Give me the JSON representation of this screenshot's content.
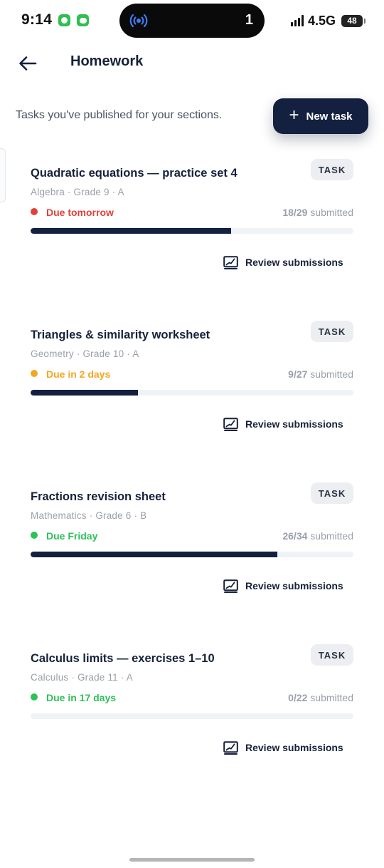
{
  "status_bar": {
    "time": "9:14",
    "island_count": "1",
    "network": "4.5G",
    "battery": "48"
  },
  "header": {
    "title": "Homework"
  },
  "subtitle": "Tasks you've published for your sections.",
  "new_task_label": "New task",
  "colors": {
    "navy": "#13203f",
    "red": "#e0413a",
    "orange": "#f5a623",
    "green": "#2ec15a",
    "track": "#eff2f6"
  },
  "tasks": [
    {
      "title": "Quadratic equations — practice set 4",
      "meta": "Algebra · Grade 9 · A",
      "badge": "TASK",
      "due": "Due tomorrow",
      "due_color": "#e0413a",
      "submitted_count": "18/29",
      "submitted_label": "submitted",
      "progress": 0.621,
      "review_label": "Review submissions"
    },
    {
      "title": "Triangles & similarity worksheet",
      "meta": "Geometry · Grade 10 · A",
      "badge": "TASK",
      "due": "Due in 2 days",
      "due_color": "#f5a623",
      "submitted_count": "9/27",
      "submitted_label": "submitted",
      "progress": 0.333,
      "review_label": "Review submissions"
    },
    {
      "title": "Fractions revision sheet",
      "meta": "Mathematics · Grade 6 · B",
      "badge": "TASK",
      "due": "Due Friday",
      "due_color": "#2ec15a",
      "submitted_count": "26/34",
      "submitted_label": "submitted",
      "progress": 0.765,
      "review_label": "Review submissions"
    },
    {
      "title": "Calculus limits — exercises 1–10",
      "meta": "Calculus · Grade 11 · A",
      "badge": "TASK",
      "due": "Due in 17 days",
      "due_color": "#2ec15a",
      "submitted_count": "0/22",
      "submitted_label": "submitted",
      "progress": 0,
      "review_label": "Review submissions"
    }
  ]
}
